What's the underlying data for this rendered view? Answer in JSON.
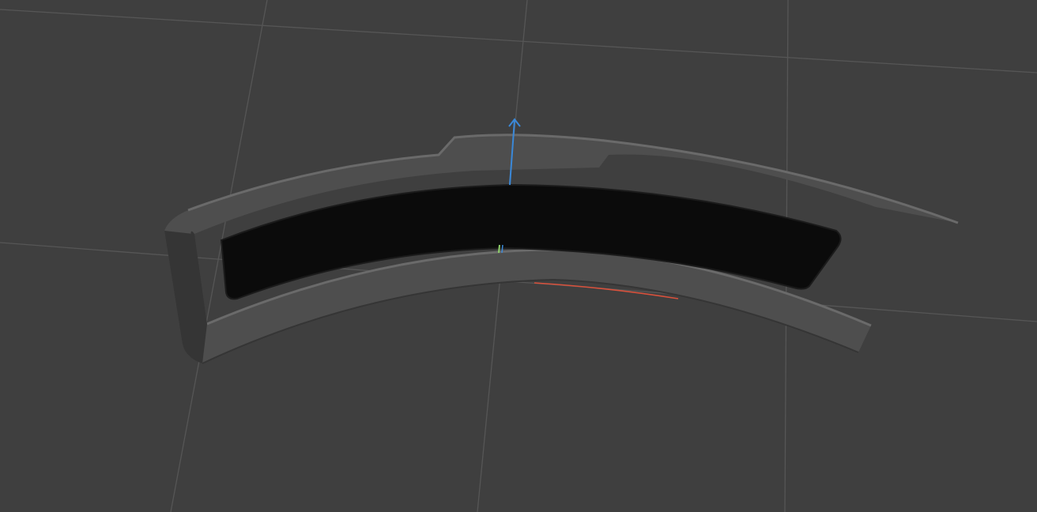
{
  "viewport": {
    "background": "#3f3f3f",
    "grid_color": "#565656",
    "grid_visible": true
  },
  "model": {
    "frame_color": "#4e4e4e",
    "frame_highlight": "#6a6a6a",
    "frame_shadow": "#353535",
    "panel_color": "#0b0b0b",
    "panel_edge": "#1b1b1b"
  },
  "gizmo": {
    "z_axis_color": "#3a88d8",
    "y_axis_color": "#8fd26a",
    "x_axis_color": "#d8513c",
    "icons": [
      "z-axis-arrow-icon",
      "y-axis-line-icon",
      "x-axis-curve-icon"
    ]
  }
}
